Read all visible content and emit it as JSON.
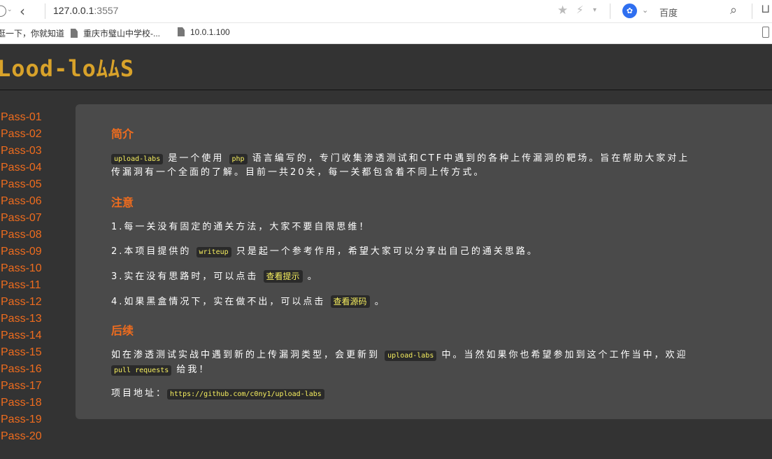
{
  "browser": {
    "url_host": "127.0.0.1",
    "url_port": ":3557",
    "search_engine": "百度",
    "bookmarks": [
      "逛一下，你就知道",
      "重庆市璧山中学校-...",
      "10.0.1.100"
    ]
  },
  "site": {
    "logo": "Lood-loﾑﾑS",
    "brand_color": "#d8a22a",
    "accent_color": "#ef6c1e"
  },
  "sidebar": {
    "items": [
      "Pass-01",
      "Pass-02",
      "Pass-03",
      "Pass-04",
      "Pass-05",
      "Pass-06",
      "Pass-07",
      "Pass-08",
      "Pass-09",
      "Pass-10",
      "Pass-11",
      "Pass-12",
      "Pass-13",
      "Pass-14",
      "Pass-15",
      "Pass-16",
      "Pass-17",
      "Pass-18",
      "Pass-19",
      "Pass-20"
    ]
  },
  "content": {
    "intro_title": "简介",
    "intro_code1": "upload-labs",
    "intro_t1": " 是一个使用 ",
    "intro_code2": "php",
    "intro_t2": " 语言编写的，专门收集渗透测试和CTF中遇到的各种上传漏洞的靶场。旨在帮助大家对上",
    "intro_line2": "传漏洞有一个全面的了解。目前一共20关，每一关都包含着不同上传方式。",
    "notice_title": "注意",
    "n1": "1.每一关没有固定的通关方法，大家不要自限思维！",
    "n2_a": "2.本项目提供的 ",
    "n2_code": "writeup",
    "n2_b": " 只是起一个参考作用，希望大家可以分享出自己的通关思路。",
    "n3_a": "3.实在没有思路时，可以点击 ",
    "n3_btn": "查看提示",
    "n3_b": " 。",
    "n4_a": "4.如果黑盒情况下，实在做不出，可以点击 ",
    "n4_btn": "查看源码",
    "n4_b": " 。",
    "follow_title": "后续",
    "f1_a": "如在渗透测试实战中遇到新的上传漏洞类型，会更新到 ",
    "f1_code": "upload-labs",
    "f1_b": " 中。当然如果你也希望参加到这个工作当中，欢迎",
    "f2_code": "pull requests",
    "f2_b": " 给我！",
    "addr_label": "项目地址：",
    "addr_link": "https://github.com/c0ny1/upload-labs"
  }
}
